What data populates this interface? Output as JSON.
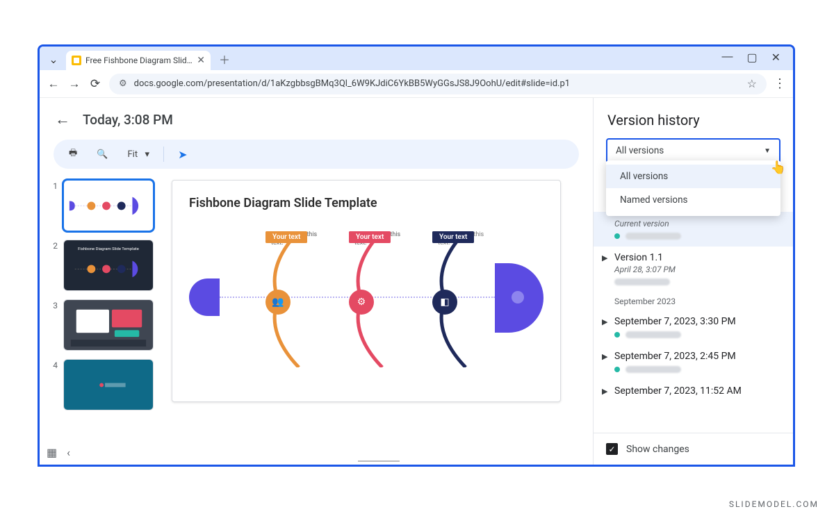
{
  "browser": {
    "tab_title": "Free Fishbone Diagram Slide Te",
    "url": "docs.google.com/presentation/d/1aKzgbbsgBMq3Ql_6W9KJdiC6YkBB5WyGGsJS8J9OohU/edit#slide=id.p1"
  },
  "header": {
    "title": "Today, 3:08 PM"
  },
  "toolbar": {
    "zoom_label": "Fit"
  },
  "slide": {
    "title": "Fishbone Diagram Slide Template",
    "tag": "Your text",
    "caption": "You can edit this text."
  },
  "thumbs": [
    "1",
    "2",
    "3",
    "4"
  ],
  "panel": {
    "title": "Version history",
    "filter_label": "All versions",
    "dropdown": {
      "all": "All versions",
      "named": "Named versions"
    },
    "current_sub": "Current version",
    "versions": [
      {
        "name": "Version 1.1",
        "date": "April 28, 3:07 PM"
      }
    ],
    "section": "September 2023",
    "older": [
      "September 7, 2023, 3:30 PM",
      "September 7, 2023, 2:45 PM",
      "September 7, 2023, 11:52 AM"
    ],
    "show_changes": "Show changes"
  },
  "watermark": "SLIDEMODEL.COM"
}
